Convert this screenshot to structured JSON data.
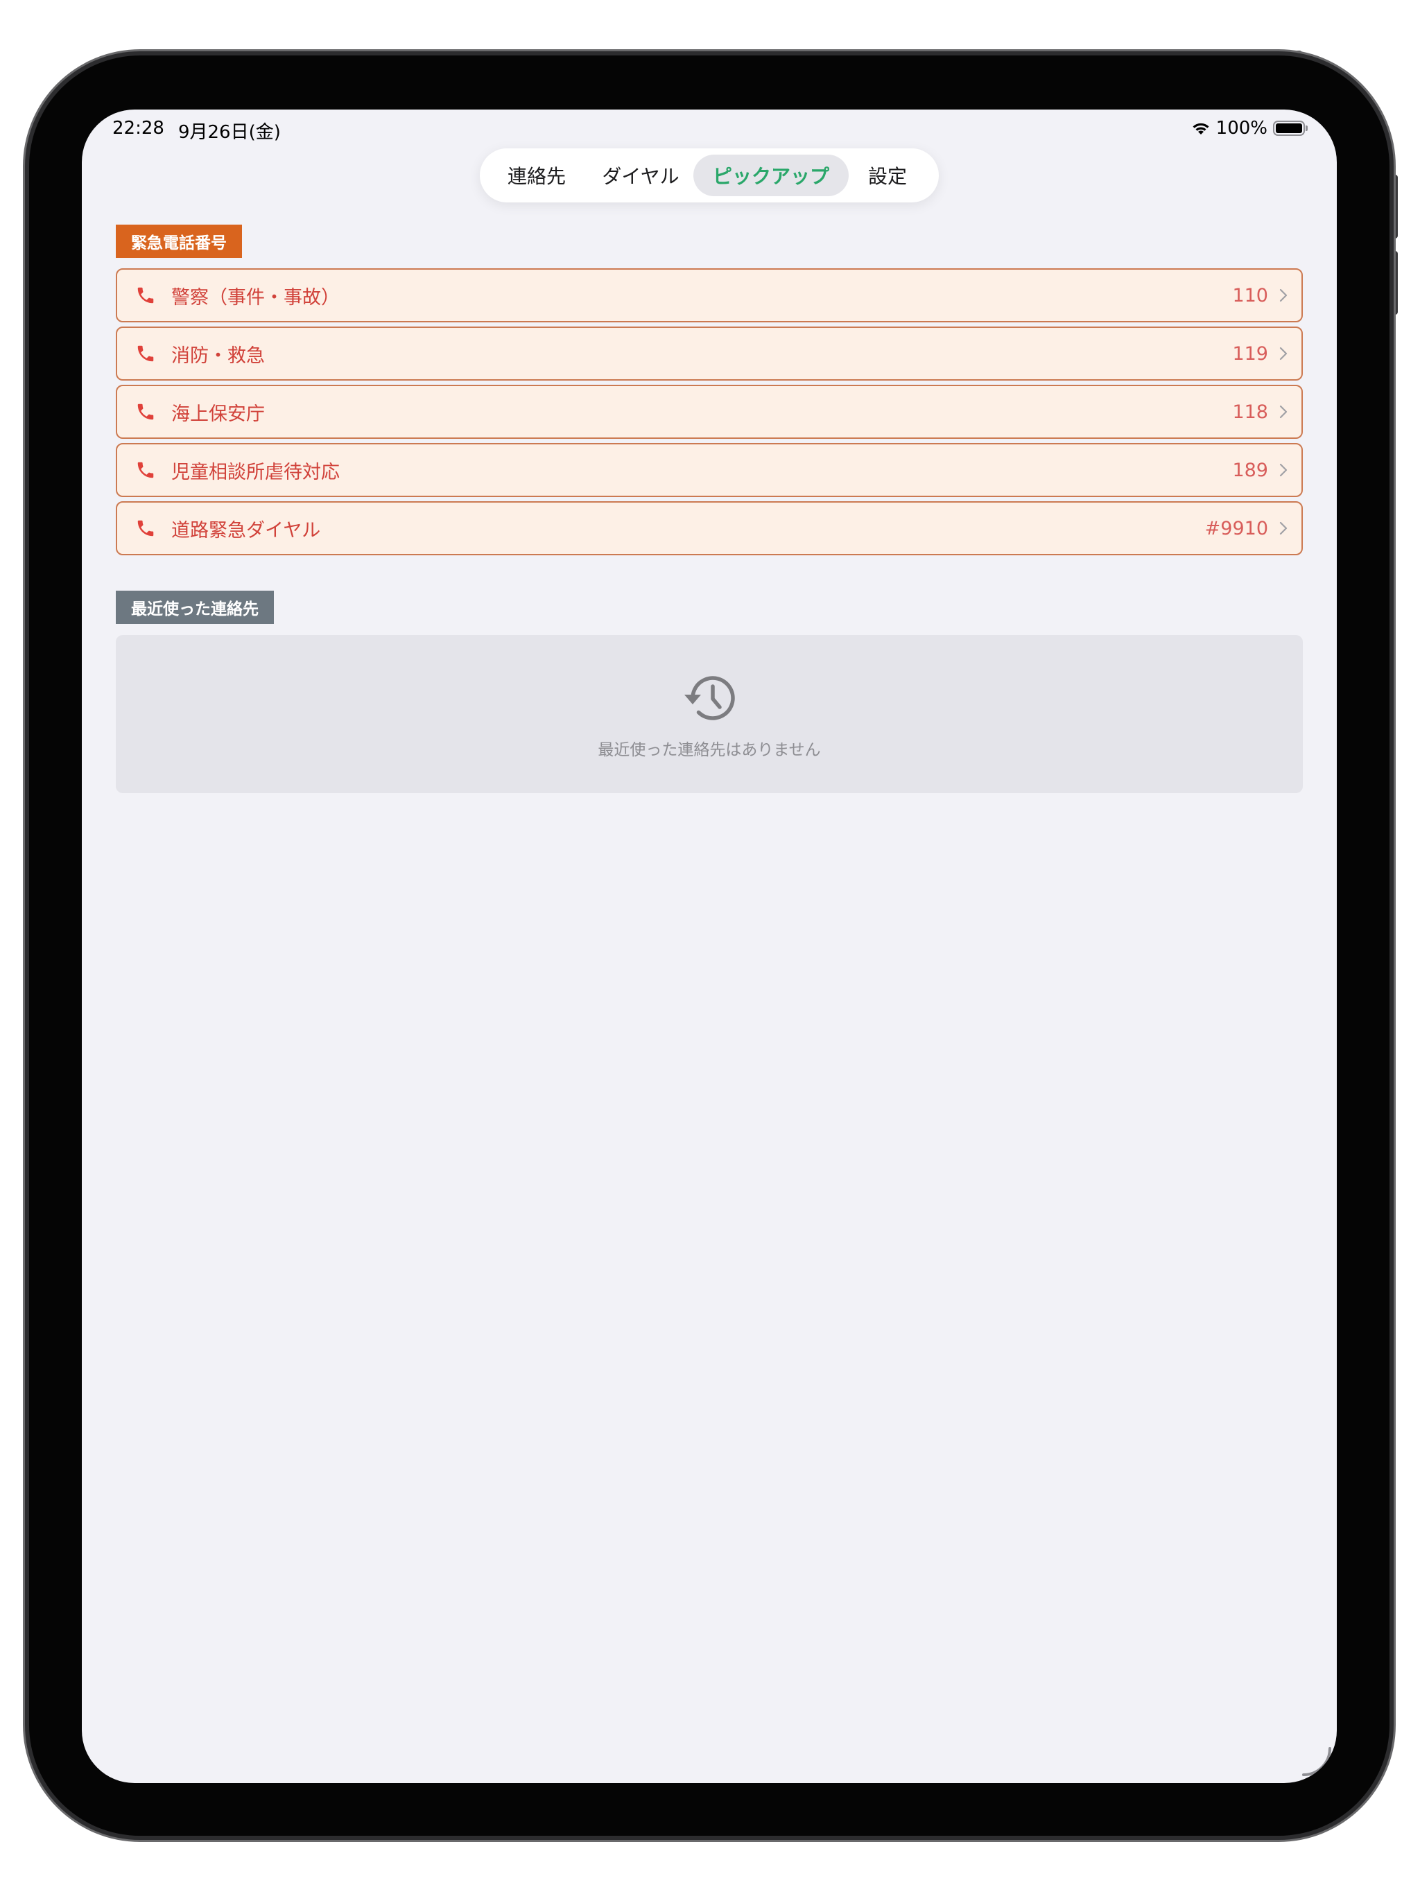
{
  "status_bar": {
    "time": "22:28",
    "date": "9月26日(金)",
    "battery": "100%",
    "battery_level": 1.0
  },
  "tabs": [
    {
      "label": "連絡先",
      "selected": false
    },
    {
      "label": "ダイヤル",
      "selected": false
    },
    {
      "label": "ピックアップ",
      "selected": true
    },
    {
      "label": "設定",
      "selected": false
    }
  ],
  "emergency": {
    "title": "緊急電話番号",
    "items": [
      {
        "name": "警察（事件・事故）",
        "number": "110"
      },
      {
        "name": "消防・救急",
        "number": "119"
      },
      {
        "name": "海上保安庁",
        "number": "118"
      },
      {
        "name": "児童相談所虐待対応",
        "number": "189"
      },
      {
        "name": "道路緊急ダイヤル",
        "number": "#9910"
      }
    ]
  },
  "recent": {
    "title": "最近使った連絡先",
    "empty_text": "最近使った連絡先はありません"
  },
  "colors": {
    "accent_green": "#2aa76a",
    "emergency_badge": "#d9641e",
    "emergency_text": "#d1423a",
    "recent_badge": "#6d7881"
  },
  "icons": {
    "call": "phone-icon",
    "chevron": "chevron-right-icon",
    "history": "history-icon",
    "wifi": "wifi-icon",
    "battery": "battery-icon"
  }
}
